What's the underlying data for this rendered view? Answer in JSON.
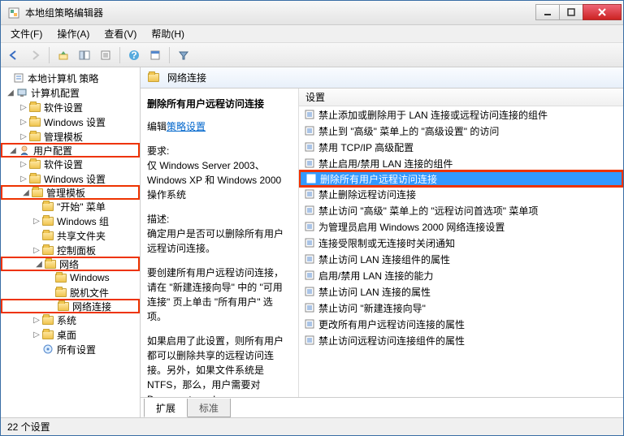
{
  "window": {
    "title": "本地组策略编辑器"
  },
  "menu": {
    "file": "文件(F)",
    "action": "操作(A)",
    "view": "查看(V)",
    "help": "帮助(H)"
  },
  "tree": {
    "root": "本地计算机 策略",
    "computer_config": "计算机配置",
    "software_settings_1": "软件设置",
    "windows_settings_1": "Windows 设置",
    "admin_templates_1": "管理模板",
    "user_config": "用户配置",
    "software_settings_2": "软件设置",
    "windows_settings_2": "Windows 设置",
    "admin_templates_2": "管理模板",
    "start_menu": "\"开始\" 菜单",
    "windows_components": "Windows 组",
    "shared_folders": "共享文件夹",
    "control_panel": "控制面板",
    "network": "网络",
    "windows_sub": "Windows",
    "offline_files": "脱机文件",
    "network_connections": "网络连接",
    "system": "系统",
    "desktop": "桌面",
    "all_settings": "所有设置"
  },
  "path": {
    "label": "网络连接"
  },
  "desc": {
    "title": "删除所有用户远程访问连接",
    "edit_prefix": "编辑",
    "edit_link": "策略设置",
    "req_label": "要求:",
    "req_text": "仅 Windows Server 2003、Windows XP 和 Windows 2000 操作系统",
    "desc_label": "描述:",
    "desc_text1": "确定用户是否可以删除所有用户远程访问连接。",
    "desc_text2": "要创建所有用户远程访问连接，请在 \"新建连接向导\" 中的 \"可用连接\" 页上单击 \"所有用户\" 选项。",
    "desc_text3": "如果启用了此设置，则所有用户都可以删除共享的远程访问连接。另外，如果文件系统是 NTFS，那么，用户需要对 Documents and"
  },
  "list": {
    "header": "设置",
    "items": [
      "禁止添加或删除用于 LAN 连接或远程访问连接的组件",
      "禁止到 \"高级\" 菜单上的 \"高级设置\" 的访问",
      "禁用 TCP/IP 高级配置",
      "禁止启用/禁用 LAN 连接的组件",
      "删除所有用户远程访问连接",
      "禁止删除远程访问连接",
      "禁止访问 \"高级\" 菜单上的 \"远程访问首选项\" 菜单项",
      "为管理员启用 Windows 2000 网络连接设置",
      "连接受限制或无连接时关闭通知",
      "禁止访问 LAN 连接组件的属性",
      "启用/禁用 LAN 连接的能力",
      "禁止访问 LAN 连接的属性",
      "禁止访问 \"新建连接向导\"",
      "更改所有用户远程访问连接的属性",
      "禁止访问远程访问连接组件的属性"
    ],
    "selected_index": 4
  },
  "tabs": {
    "extended": "扩展",
    "standard": "标准"
  },
  "status": {
    "text": "22 个设置"
  }
}
